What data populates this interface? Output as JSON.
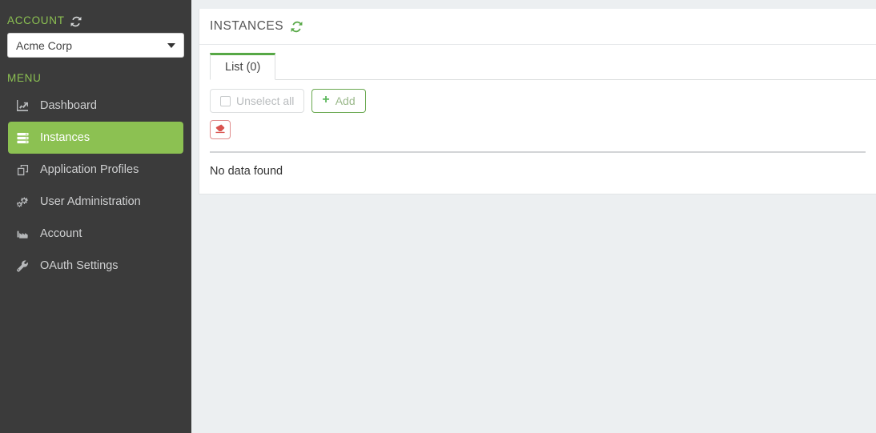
{
  "sidebar": {
    "account_label": "ACCOUNT",
    "account_refresh_icon": "refresh-icon",
    "account_value": "Acme Corp",
    "menu_label": "MENU",
    "items": [
      {
        "label": "Dashboard",
        "icon": "line-chart-icon",
        "active": false
      },
      {
        "label": "Instances",
        "icon": "server-icon",
        "active": true
      },
      {
        "label": "Application Profiles",
        "icon": "clone-icon",
        "active": false
      },
      {
        "label": "User Administration",
        "icon": "cogs-icon",
        "active": false
      },
      {
        "label": "Account",
        "icon": "industry-icon",
        "active": false
      },
      {
        "label": "OAuth Settings",
        "icon": "wrench-icon",
        "active": false
      }
    ]
  },
  "main": {
    "title": "INSTANCES",
    "title_refresh_icon": "refresh-icon",
    "tabs": [
      {
        "label": "List (0)",
        "active": true
      }
    ],
    "toolbar": {
      "unselect_label": "Unselect all",
      "unselect_icon": "checkbox-icon",
      "add_label": "Add",
      "add_icon": "plus-icon",
      "erase_icon": "eraser-icon"
    },
    "empty_message": "No data found"
  },
  "colors": {
    "accent_green": "#8cc152",
    "header_green": "#57a846",
    "sidebar_dark": "#3b3b3b",
    "page_bg": "#eceff1",
    "danger_red": "#d9534f"
  }
}
